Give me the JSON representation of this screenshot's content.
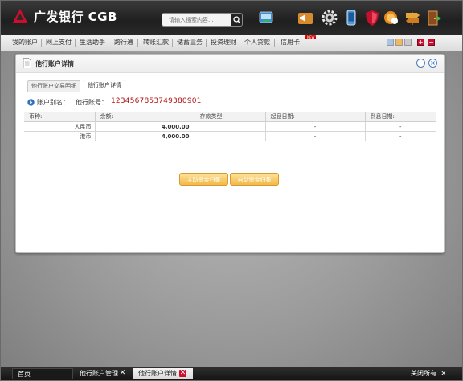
{
  "header": {
    "logo_text": "广发银行 CGB",
    "search_placeholder": "请输入搜索内容...",
    "icons": [
      "transfer-icon",
      "megaphone-icon",
      "gear-icon",
      "mobile-icon",
      "shield-icon",
      "globe-user-icon",
      "signpost-icon",
      "exit-door-icon"
    ]
  },
  "nav": {
    "items": [
      "我的账户",
      "网上支付",
      "生活助手",
      "跨行通",
      "转账汇款",
      "储蓄业务",
      "投资理财",
      "个人贷款",
      "信用卡"
    ],
    "new_badge": "NEW"
  },
  "panel": {
    "title": "他行账户详情",
    "tabs": [
      "他行账户交易明细",
      "他行账户详情"
    ],
    "alias_label": "账户别名：",
    "account_no_label": "他行账号：",
    "account_no": "1234567853749380901",
    "table": {
      "headers": [
        "币种:",
        "余额:",
        "存款类型:",
        "起息日期:",
        "到息日期:"
      ],
      "rows": [
        [
          "人民币",
          "4,000.00",
          "",
          "-",
          "-"
        ],
        [
          "港币",
          "4,000.00",
          "",
          "-",
          "-"
        ]
      ]
    },
    "buttons": {
      "manual": "主动资金归集",
      "auto": "自动资金归集"
    }
  },
  "taskbar": {
    "home": "首页",
    "tasks": [
      "他行账户管理",
      "他行账户详情"
    ],
    "close_all": "关闭所有"
  },
  "colors": {
    "accent_red": "#b01010",
    "brand_red": "#c8102e",
    "button_gold": "#f2b84a"
  }
}
